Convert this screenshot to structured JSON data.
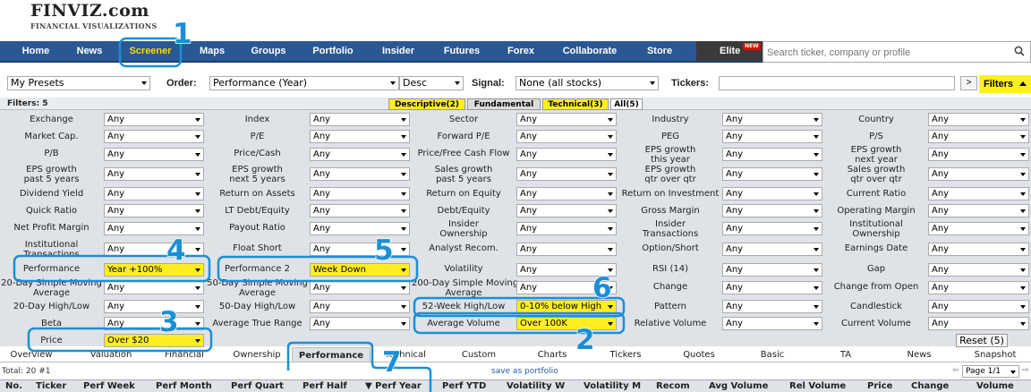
{
  "logo": {
    "title": "FINVIZ.com",
    "subtitle": "FINANCIAL VISUALIZATIONS"
  },
  "nav": {
    "items": [
      "Home",
      "News",
      "Screener",
      "Maps",
      "Groups",
      "Portfolio",
      "Insider",
      "Futures",
      "Forex",
      "Collaborate",
      "Store"
    ],
    "active": "Screener",
    "elite": "Elite",
    "elite_badge": "NEW",
    "search_placeholder": "Search ticker, company or profile"
  },
  "controls": {
    "presets": "My Presets",
    "order_label": "Order:",
    "order_value": "Performance (Year)",
    "direction": "Desc",
    "signal_label": "Signal:",
    "signal_value": "None (all stocks)",
    "tickers_label": "Tickers:",
    "go": ">",
    "filters_button": "Filters"
  },
  "filters_header": {
    "count": "Filters: 5",
    "tabs": [
      "Descriptive(2)",
      "Fundamental",
      "Technical(3)",
      "All(5)"
    ]
  },
  "filter_rows": [
    [
      "Exchange",
      "Any",
      "Index",
      "Any",
      "Sector",
      "Any",
      "Industry",
      "Any",
      "Country",
      "Any"
    ],
    [
      "Market Cap.",
      "Any",
      "P/E",
      "Any",
      "Forward P/E",
      "Any",
      "PEG",
      "Any",
      "P/S",
      "Any"
    ],
    [
      "P/B",
      "Any",
      "Price/Cash",
      "Any",
      "Price/Free Cash Flow",
      "Any",
      "EPS growth\nthis year",
      "Any",
      "EPS growth\nnext year",
      "Any"
    ],
    [
      "EPS growth\npast 5 years",
      "Any",
      "EPS growth\nnext 5 years",
      "Any",
      "Sales growth\npast 5 years",
      "Any",
      "EPS growth\nqtr over qtr",
      "Any",
      "Sales growth\nqtr over qtr",
      "Any"
    ],
    [
      "Dividend Yield",
      "Any",
      "Return on Assets",
      "Any",
      "Return on Equity",
      "Any",
      "Return on Investment",
      "Any",
      "Current Ratio",
      "Any"
    ],
    [
      "Quick Ratio",
      "Any",
      "LT Debt/Equity",
      "Any",
      "Debt/Equity",
      "Any",
      "Gross Margin",
      "Any",
      "Operating Margin",
      "Any"
    ],
    [
      "Net Profit Margin",
      "Any",
      "Payout Ratio",
      "Any",
      "Insider\nOwnership",
      "Any",
      "Insider\nTransactions",
      "Any",
      "Institutional\nOwnership",
      "Any"
    ],
    [
      "Institutional\nTransactions",
      "Any",
      "Float Short",
      "Any",
      "Analyst Recom.",
      "Any",
      "Option/Short",
      "Any",
      "Earnings Date",
      "Any"
    ],
    [
      "Performance",
      "Year +100%",
      "Performance 2",
      "Week Down",
      "Volatility",
      "Any",
      "RSI (14)",
      "Any",
      "Gap",
      "Any"
    ],
    [
      "20-Day Simple Moving\nAverage",
      "Any",
      "50-Day Simple Moving\nAverage",
      "Any",
      "200-Day Simple Moving\nAverage",
      "Any",
      "Change",
      "Any",
      "Change from Open",
      "Any"
    ],
    [
      "20-Day High/Low",
      "Any",
      "50-Day High/Low",
      "Any",
      "52-Week High/Low",
      "0-10% below High",
      "Pattern",
      "Any",
      "Candlestick",
      "Any"
    ],
    [
      "Beta",
      "Any",
      "Average True Range",
      "Any",
      "Average Volume",
      "Over 100K",
      "Relative Volume",
      "Any",
      "Current Volume",
      "Any"
    ],
    [
      "Price",
      "Over $20",
      "",
      "",
      "",
      "",
      "",
      "",
      "",
      ""
    ]
  ],
  "reset": "Reset (5)",
  "view_tabs": [
    "Overview",
    "Valuation",
    "Financial",
    "Ownership",
    "Performance",
    "Technical",
    "Custom",
    "Charts",
    "Tickers",
    "Quotes",
    "Basic",
    "TA",
    "News",
    "Snapshot"
  ],
  "view_active": "Performance",
  "results": {
    "total": "Total: 20 #1",
    "save": "save as portfolio",
    "page": "Page 1/1"
  },
  "columns": [
    "No.",
    "Ticker",
    "Perf Week",
    "Perf Month",
    "Perf Quart",
    "Perf Half",
    "▼ Perf Year",
    "Perf YTD",
    "Volatility W",
    "Volatility M",
    "Recom",
    "Avg Volume",
    "Rel Volume",
    "Price",
    "Change",
    "Volume"
  ],
  "annotations": [
    "1",
    "2",
    "3",
    "4",
    "5",
    "6",
    "7"
  ],
  "colors": {
    "nav": "#2a5895",
    "highlight": "#ffee22",
    "annotation": "#1a8fd6",
    "panel": "#dfe2e7"
  }
}
